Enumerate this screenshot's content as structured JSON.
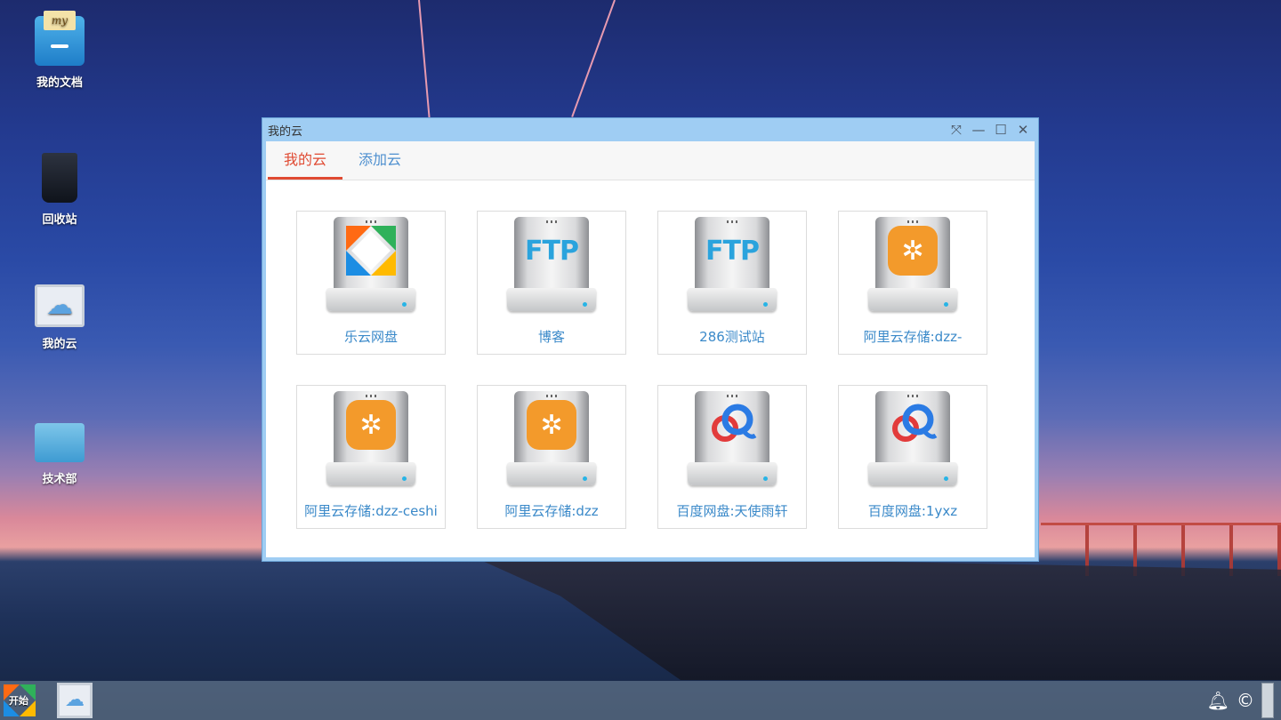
{
  "desktop": {
    "icons": [
      {
        "label": "我的文档"
      },
      {
        "label": "回收站"
      },
      {
        "label": "我的云"
      },
      {
        "label": "技术部"
      }
    ]
  },
  "window": {
    "title": "我的云",
    "controls": [
      "fullscreen-icon",
      "minimize-icon",
      "maximize-icon",
      "close-icon"
    ],
    "tabs": [
      {
        "label": "我的云",
        "active": true
      },
      {
        "label": "添加云",
        "active": false
      }
    ],
    "clouds": [
      {
        "label": "乐云网盘",
        "logo": "leyun-logo"
      },
      {
        "label": "博客",
        "logo": "ftp-logo",
        "logo_text": "FTP"
      },
      {
        "label": "286测试站",
        "logo": "ftp-logo",
        "logo_text": "FTP"
      },
      {
        "label": "阿里云存储:dzz-",
        "logo": "aliyun-logo"
      },
      {
        "label": "阿里云存储:dzz-ceshi",
        "logo": "aliyun-logo"
      },
      {
        "label": "阿里云存储:dzz",
        "logo": "aliyun-logo"
      },
      {
        "label": "百度网盘:天使雨轩",
        "logo": "baidu-logo"
      },
      {
        "label": "百度网盘:1yxz",
        "logo": "baidu-logo"
      }
    ]
  },
  "taskbar": {
    "start_label": "开始",
    "tray": [
      "bell-icon",
      "copyright-icon"
    ]
  },
  "colors": {
    "accent_active_tab": "#e04a32",
    "link_blue": "#3a89c9",
    "window_frame": "#9fcdf3"
  }
}
